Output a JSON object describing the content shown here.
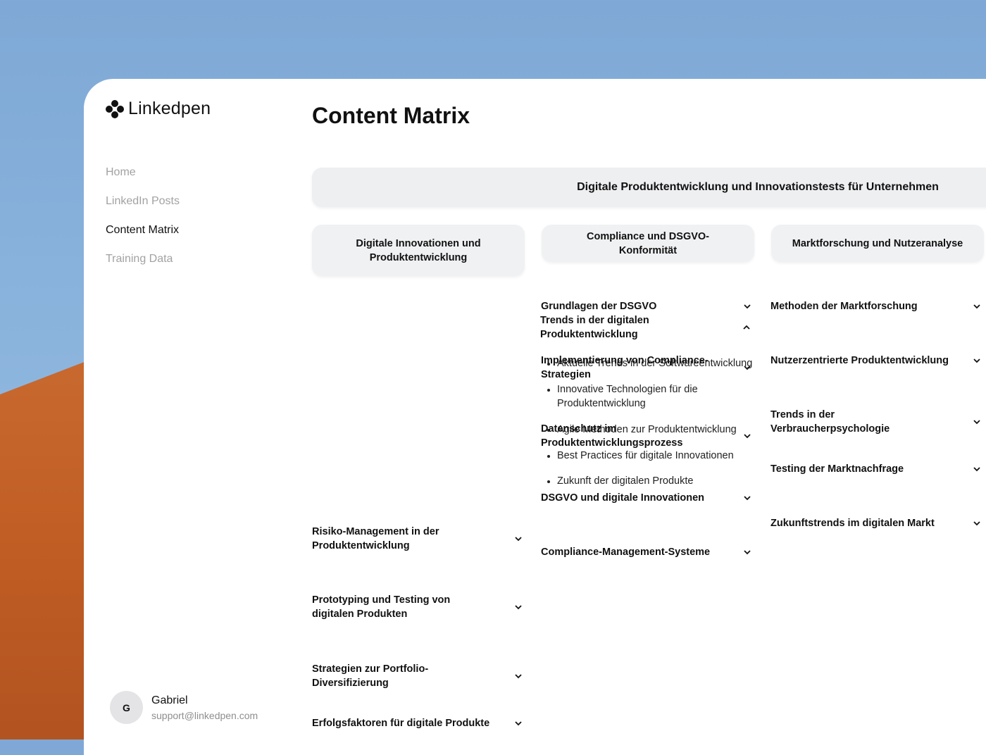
{
  "app": {
    "brand": "Linkedpen"
  },
  "sidebar": {
    "nav": [
      "Home",
      "LinkedIn Posts",
      "Content Matrix",
      "Training Data"
    ],
    "active": "Content Matrix"
  },
  "user": {
    "initial": "G",
    "name": "Gabriel",
    "email": "support@linkedpen.com"
  },
  "page": {
    "title": "Content Matrix"
  },
  "topic": "Digitale Produktentwicklung und Innovationstests für Unternehmen",
  "columns": [
    {
      "header": "Digitale Innovationen und Produktentwicklung",
      "items": [
        {
          "label": "Trends in der digitalen Produktentwicklung",
          "expanded": true,
          "subitems": [
            "Aktuelle Trends in der Softwareentwicklung",
            "Innovative Technologien für die Produktentwicklung",
            "Agile Methoden zur Produktentwicklung",
            "Best Practices für digitale Innovationen",
            "Zukunft der digitalen Produkte"
          ]
        },
        {
          "label": "Risiko-Management in der Produktentwicklung",
          "expanded": false
        },
        {
          "label": "Prototyping und Testing von digitalen Produkten",
          "expanded": false
        },
        {
          "label": "Strategien zur Portfolio-Diversifizierung",
          "expanded": false
        },
        {
          "label": "Erfolgsfaktoren für digitale Produkte",
          "expanded": false
        }
      ]
    },
    {
      "header": "Compliance und DSGVO-Konformität",
      "items": [
        {
          "label": "Grundlagen der DSGVO",
          "expanded": false
        },
        {
          "label": "Implementierung von Compliance-Strategien",
          "expanded": false
        },
        {
          "label": "Datenschutz im Produktentwicklungsprozess",
          "expanded": false
        },
        {
          "label": "DSGVO und digitale Innovationen",
          "expanded": false
        },
        {
          "label": "Compliance-Management-Systeme",
          "expanded": false
        }
      ]
    },
    {
      "header": "Marktforschung und Nutzeranalyse",
      "items": [
        {
          "label": "Methoden der Marktforschung",
          "expanded": false
        },
        {
          "label": "Nutzerzentrierte Produktentwicklung",
          "expanded": false
        },
        {
          "label": "Trends in der Verbraucherpsychologie",
          "expanded": false
        },
        {
          "label": "Testing der Marktnachfrage",
          "expanded": false
        },
        {
          "label": "Zukunftstrends im digitalen Markt",
          "expanded": false
        }
      ]
    }
  ]
}
